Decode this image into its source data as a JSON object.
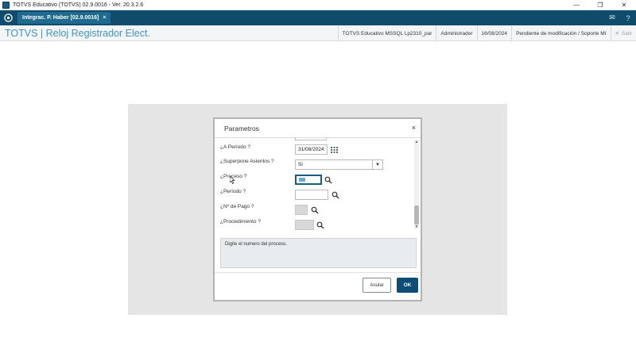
{
  "window": {
    "title": "TOTVS Educativo (TOTVS) 02.9.0016 - Ver. 20.3.2.6",
    "controls": {
      "minimize": "—",
      "restore": "❐",
      "close": "✕"
    }
  },
  "tabbar": {
    "home_icon": "home-logo-icon",
    "tab": {
      "label": "Integrac. P. Haber [02.9.0016]",
      "close": "×"
    },
    "mail_icon": "✉",
    "help_icon": "?"
  },
  "header": {
    "title": "TOTVS | Reloj Registrador Elect.",
    "environment": "TOTVS Educativo MSSQL Lp2310_par",
    "user": "Administrador",
    "date": "16/08/2024",
    "status": "Pendiente de modificación / Soporte MI",
    "exit_icon": "✕",
    "exit_label": "Salir"
  },
  "dialog": {
    "title": "Parametros",
    "close": "×",
    "fields": [
      {
        "label": "¿A Período ?",
        "value": "31/08/2024",
        "type": "date"
      },
      {
        "label": "¿Superpone Asientos ?",
        "value": "Si",
        "type": "select"
      },
      {
        "label": "¿Proceso ?",
        "value": "",
        "type": "search-focused"
      },
      {
        "label": "¿Período ?",
        "value": "",
        "type": "search"
      },
      {
        "label": "¿Nº de Pago ?",
        "value": "",
        "type": "search-disabled"
      },
      {
        "label": "¿Procedimiento ?",
        "value": "",
        "type": "search-disabled"
      }
    ],
    "help_text": "Digite el numero del proceso.",
    "cancel_label": "Anular",
    "ok_label": "OK"
  },
  "colors": {
    "tabbar_bg": "#0f4b6a",
    "title_blue": "#3f95c8",
    "ok_button": "#0c4e78"
  }
}
